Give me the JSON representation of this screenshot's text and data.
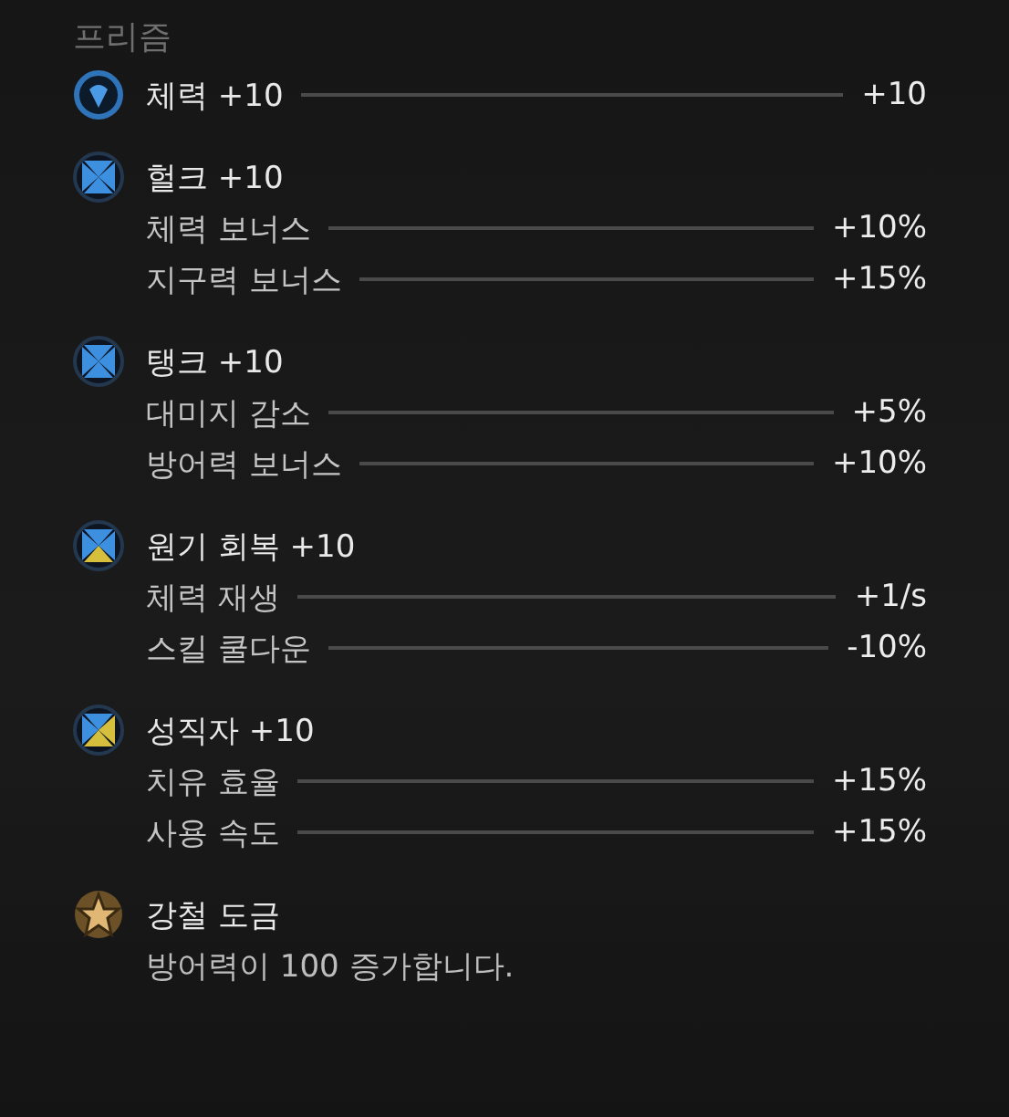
{
  "title": "프리즘",
  "sections": [
    {
      "kind": "stat",
      "icon": {
        "kind": "shield"
      },
      "label": "체력 +10",
      "value": "+10"
    },
    {
      "kind": "group",
      "icon": {
        "kind": "quad",
        "segments": [
          {
            "color": "#3d8fe0"
          },
          {
            "color": "#3d8fe0"
          },
          {
            "color": "#3d8fe0"
          },
          {
            "color": "#3d8fe0"
          }
        ]
      },
      "title": "헐크 +10",
      "stats": [
        {
          "label": "체력 보너스",
          "value": "+10%"
        },
        {
          "label": "지구력 보너스",
          "value": "+15%"
        }
      ]
    },
    {
      "kind": "group",
      "icon": {
        "kind": "quad",
        "segments": [
          {
            "color": "#3d8fe0"
          },
          {
            "color": "#3d8fe0"
          },
          {
            "color": "#3d8fe0"
          },
          {
            "color": "#3d8fe0"
          }
        ]
      },
      "title": "탱크 +10",
      "stats": [
        {
          "label": "대미지 감소",
          "value": "+5%"
        },
        {
          "label": "방어력 보너스",
          "value": "+10%"
        }
      ]
    },
    {
      "kind": "group",
      "icon": {
        "kind": "quad",
        "segments": [
          {
            "color": "#3d8fe0"
          },
          {
            "color": "#3d8fe0"
          },
          {
            "color": "#d6bf3c"
          },
          {
            "color": "#3d8fe0"
          }
        ]
      },
      "title": "원기 회복 +10",
      "stats": [
        {
          "label": "체력 재생",
          "value": "+1/s"
        },
        {
          "label": "스킬 쿨다운",
          "value": "-10%"
        }
      ]
    },
    {
      "kind": "group",
      "icon": {
        "kind": "quad",
        "segments": [
          {
            "color": "#3d8fe0"
          },
          {
            "color": "#d6bf3c"
          },
          {
            "color": "#d6bf3c"
          },
          {
            "color": "#3d8fe0"
          }
        ]
      },
      "title": "성직자 +10",
      "stats": [
        {
          "label": "치유 효율",
          "value": "+15%"
        },
        {
          "label": "사용 속도",
          "value": "+15%"
        }
      ]
    },
    {
      "kind": "note",
      "icon": {
        "kind": "star"
      },
      "title": "강철 도금",
      "text": "방어력이 100 증가합니다."
    }
  ]
}
